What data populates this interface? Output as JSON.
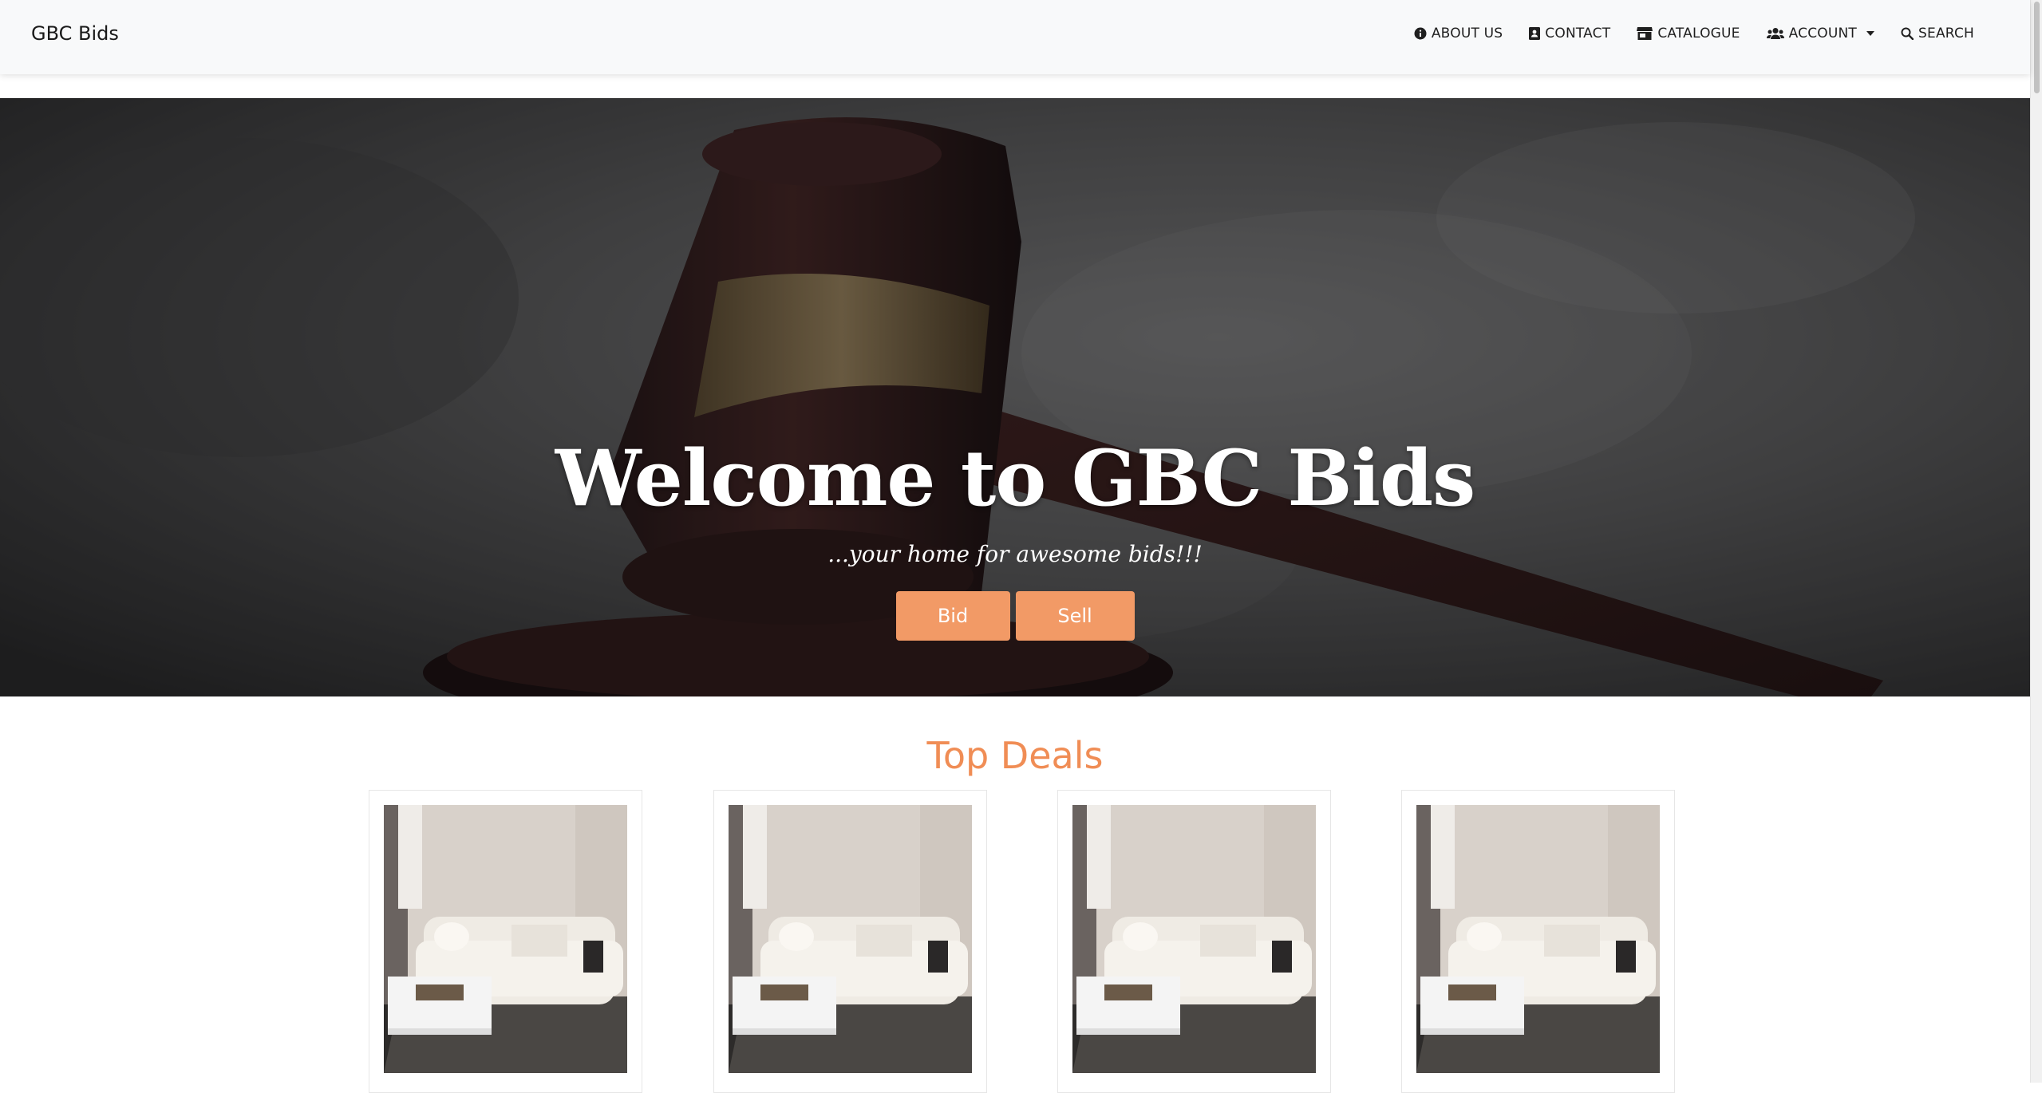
{
  "navbar": {
    "brand": "GBC Bids",
    "links": [
      {
        "label": "ABOUT US",
        "icon": "info-circle-icon"
      },
      {
        "label": "CONTACT",
        "icon": "address-book-icon"
      },
      {
        "label": "CATALOGUE",
        "icon": "store-icon"
      },
      {
        "label": "ACCOUNT",
        "icon": "users-icon",
        "dropdown": true
      },
      {
        "label": "SEARCH",
        "icon": "search-icon"
      }
    ]
  },
  "hero": {
    "title": "Welcome to GBC Bids",
    "tagline": "...your home for awesome bids!!!",
    "bid_label": "Bid",
    "sell_label": "Sell",
    "accent": "#f29a66"
  },
  "top_deals": {
    "title": "Top Deals",
    "title_color": "#f08d55",
    "cards": [
      {
        "image": "sofa-living-room-photo"
      },
      {
        "image": "sofa-living-room-photo"
      },
      {
        "image": "sofa-living-room-photo"
      },
      {
        "image": "sofa-living-room-photo"
      }
    ]
  }
}
